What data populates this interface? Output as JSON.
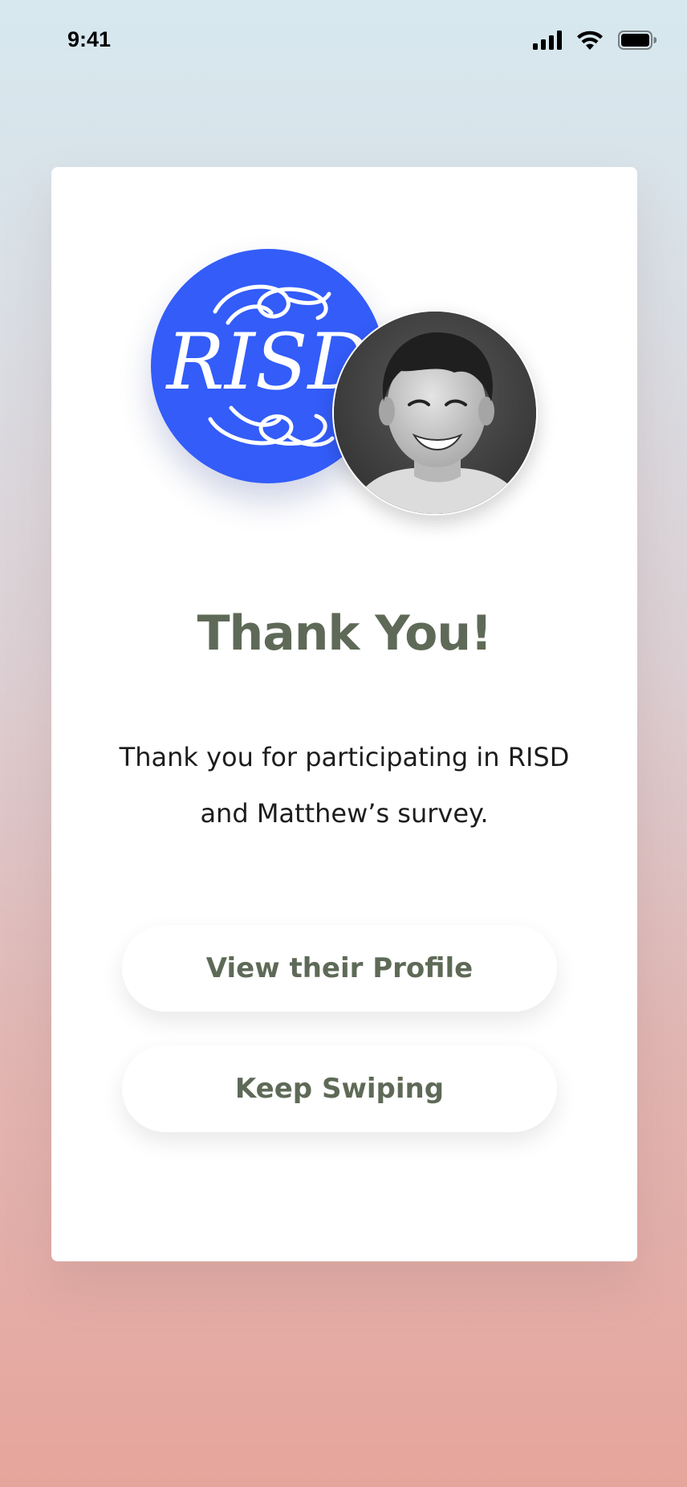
{
  "status_bar": {
    "time": "9:41",
    "icons": [
      "cellular-signal-icon",
      "wifi-icon",
      "battery-icon"
    ]
  },
  "card": {
    "logo": {
      "name": "risd-logo",
      "text": "RISD",
      "background": "#335cf9"
    },
    "profile_photo": {
      "name": "person-photo",
      "grayscale": true
    },
    "title": "Thank You!",
    "message": "Thank you for participating in RISD and Matthew’s survey.",
    "buttons": {
      "view_profile": "View their Profile",
      "keep_swiping": "Keep Swiping"
    }
  },
  "colors": {
    "accent_text": "#5e6a57",
    "logo_blue": "#335cf9",
    "gradient_top": "#d7e8ef",
    "gradient_bottom": "#e6a59c"
  }
}
